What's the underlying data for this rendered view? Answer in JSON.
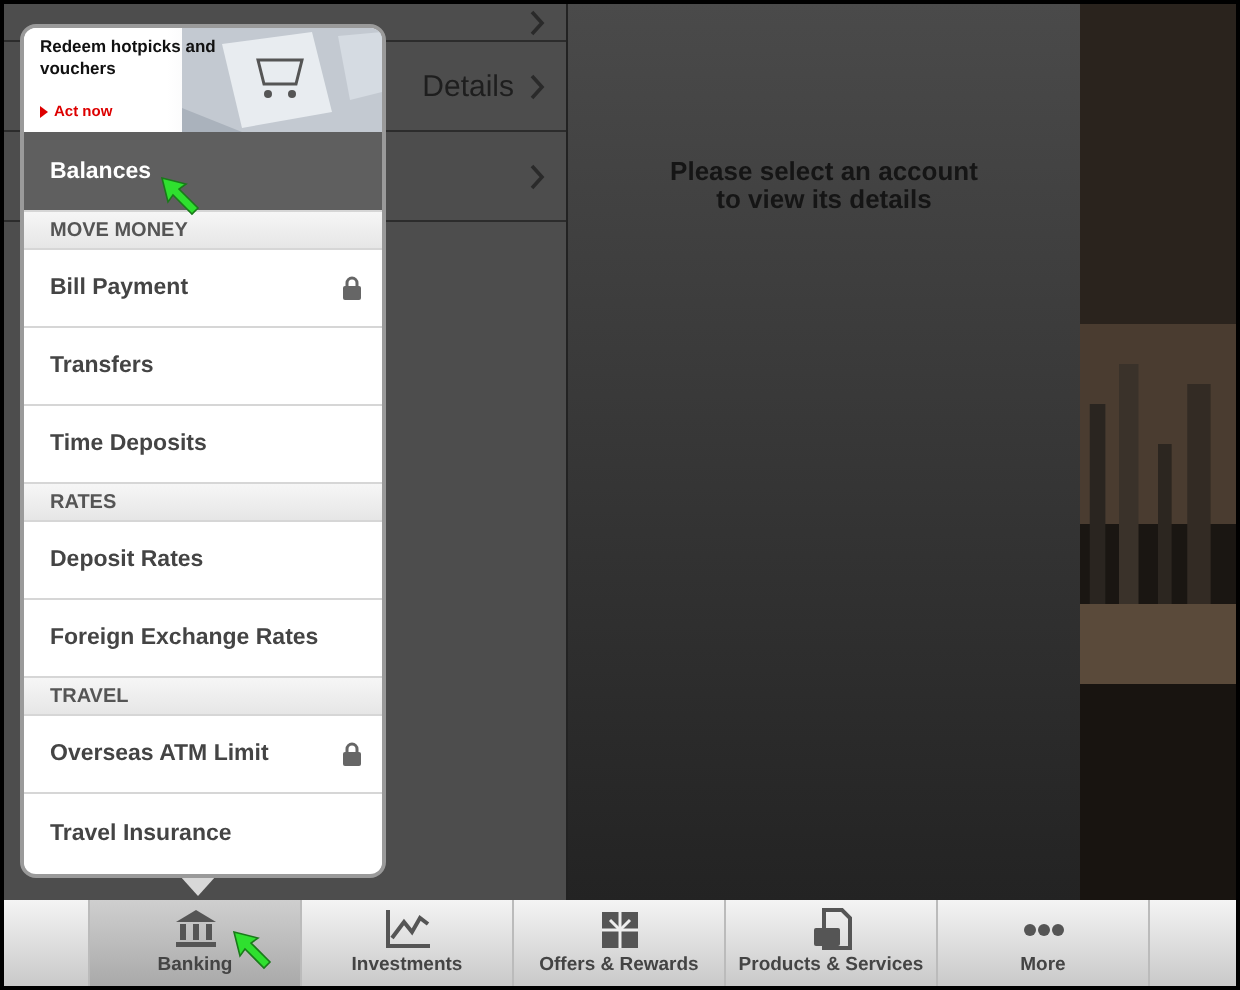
{
  "account_list": {
    "rows": [
      {
        "label": ""
      },
      {
        "label": "Details"
      },
      {
        "label": ""
      }
    ]
  },
  "detail_pane": {
    "message": "Please select an account to view its details"
  },
  "menu": {
    "banner": {
      "title": "Redeem hotpicks and vouchers",
      "link": "Act now"
    },
    "items": [
      {
        "kind": "item",
        "label": "Balances",
        "selected": true,
        "locked": false
      },
      {
        "kind": "header",
        "label": "MOVE MONEY"
      },
      {
        "kind": "item",
        "label": "Bill Payment",
        "selected": false,
        "locked": true
      },
      {
        "kind": "item",
        "label": "Transfers",
        "selected": false,
        "locked": false
      },
      {
        "kind": "item",
        "label": "Time Deposits",
        "selected": false,
        "locked": false
      },
      {
        "kind": "header",
        "label": "RATES"
      },
      {
        "kind": "item",
        "label": "Deposit Rates",
        "selected": false,
        "locked": false
      },
      {
        "kind": "item",
        "label": "Foreign Exchange Rates",
        "selected": false,
        "locked": false
      },
      {
        "kind": "header",
        "label": "TRAVEL"
      },
      {
        "kind": "item",
        "label": "Overseas ATM Limit",
        "selected": false,
        "locked": true
      },
      {
        "kind": "item",
        "label": "Travel Insurance",
        "selected": false,
        "locked": false
      }
    ]
  },
  "tab_bar": [
    {
      "label": "Banking",
      "selected": true
    },
    {
      "label": "Investments",
      "selected": false
    },
    {
      "label": "Offers & Rewards",
      "selected": false
    },
    {
      "label": "Products & Services",
      "selected": false
    },
    {
      "label": "More",
      "selected": false
    }
  ]
}
